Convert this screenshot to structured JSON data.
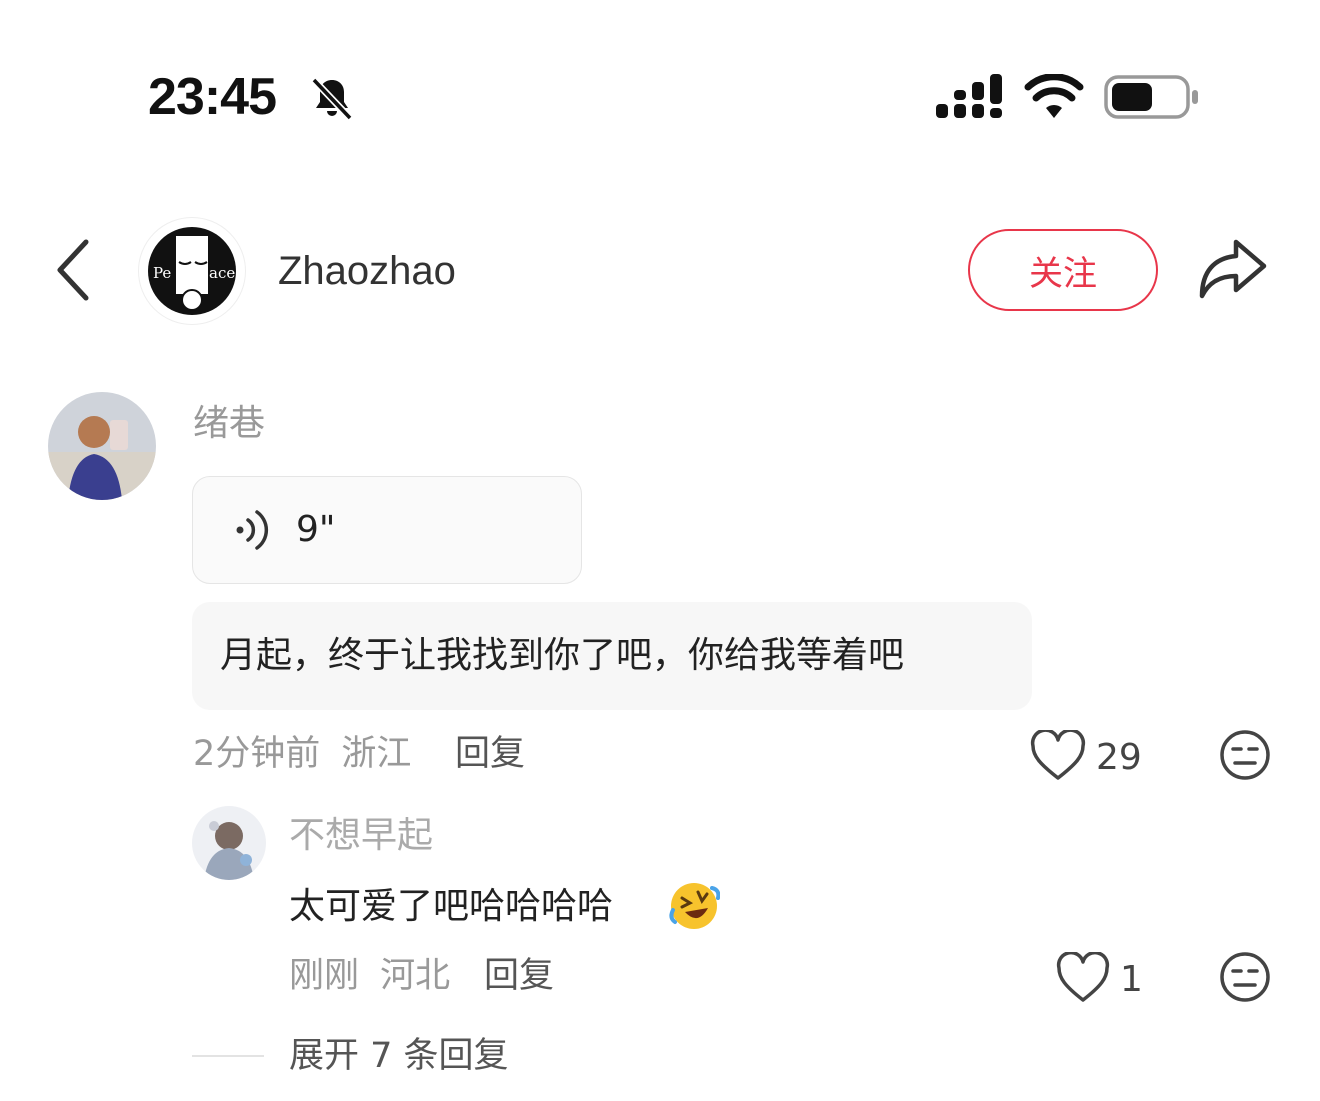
{
  "status_bar": {
    "time": "23:45",
    "icons": [
      "bell-slash-icon",
      "signal-icon",
      "wifi-icon",
      "battery-icon"
    ]
  },
  "header": {
    "back_icon": "chevron-left-icon",
    "username": "Zhaozhao",
    "follow_label": "关注",
    "share_icon": "share-arrow-icon",
    "accent_color": "#e8364a"
  },
  "comment": {
    "author": "绪巷",
    "voice_duration": "9\"",
    "text": "月起，终于让我找到你了吧，你给我等着吧",
    "time": "2分钟前",
    "location": "浙江",
    "reply_label": "回复",
    "likes": "29"
  },
  "reply": {
    "author": "不想早起",
    "text": "太可爱了吧哈哈哈哈",
    "emoji": "🤣",
    "time": "刚刚",
    "location": "河北",
    "reply_label": "回复",
    "likes": "1"
  },
  "expand_label": "展开 7 条回复"
}
